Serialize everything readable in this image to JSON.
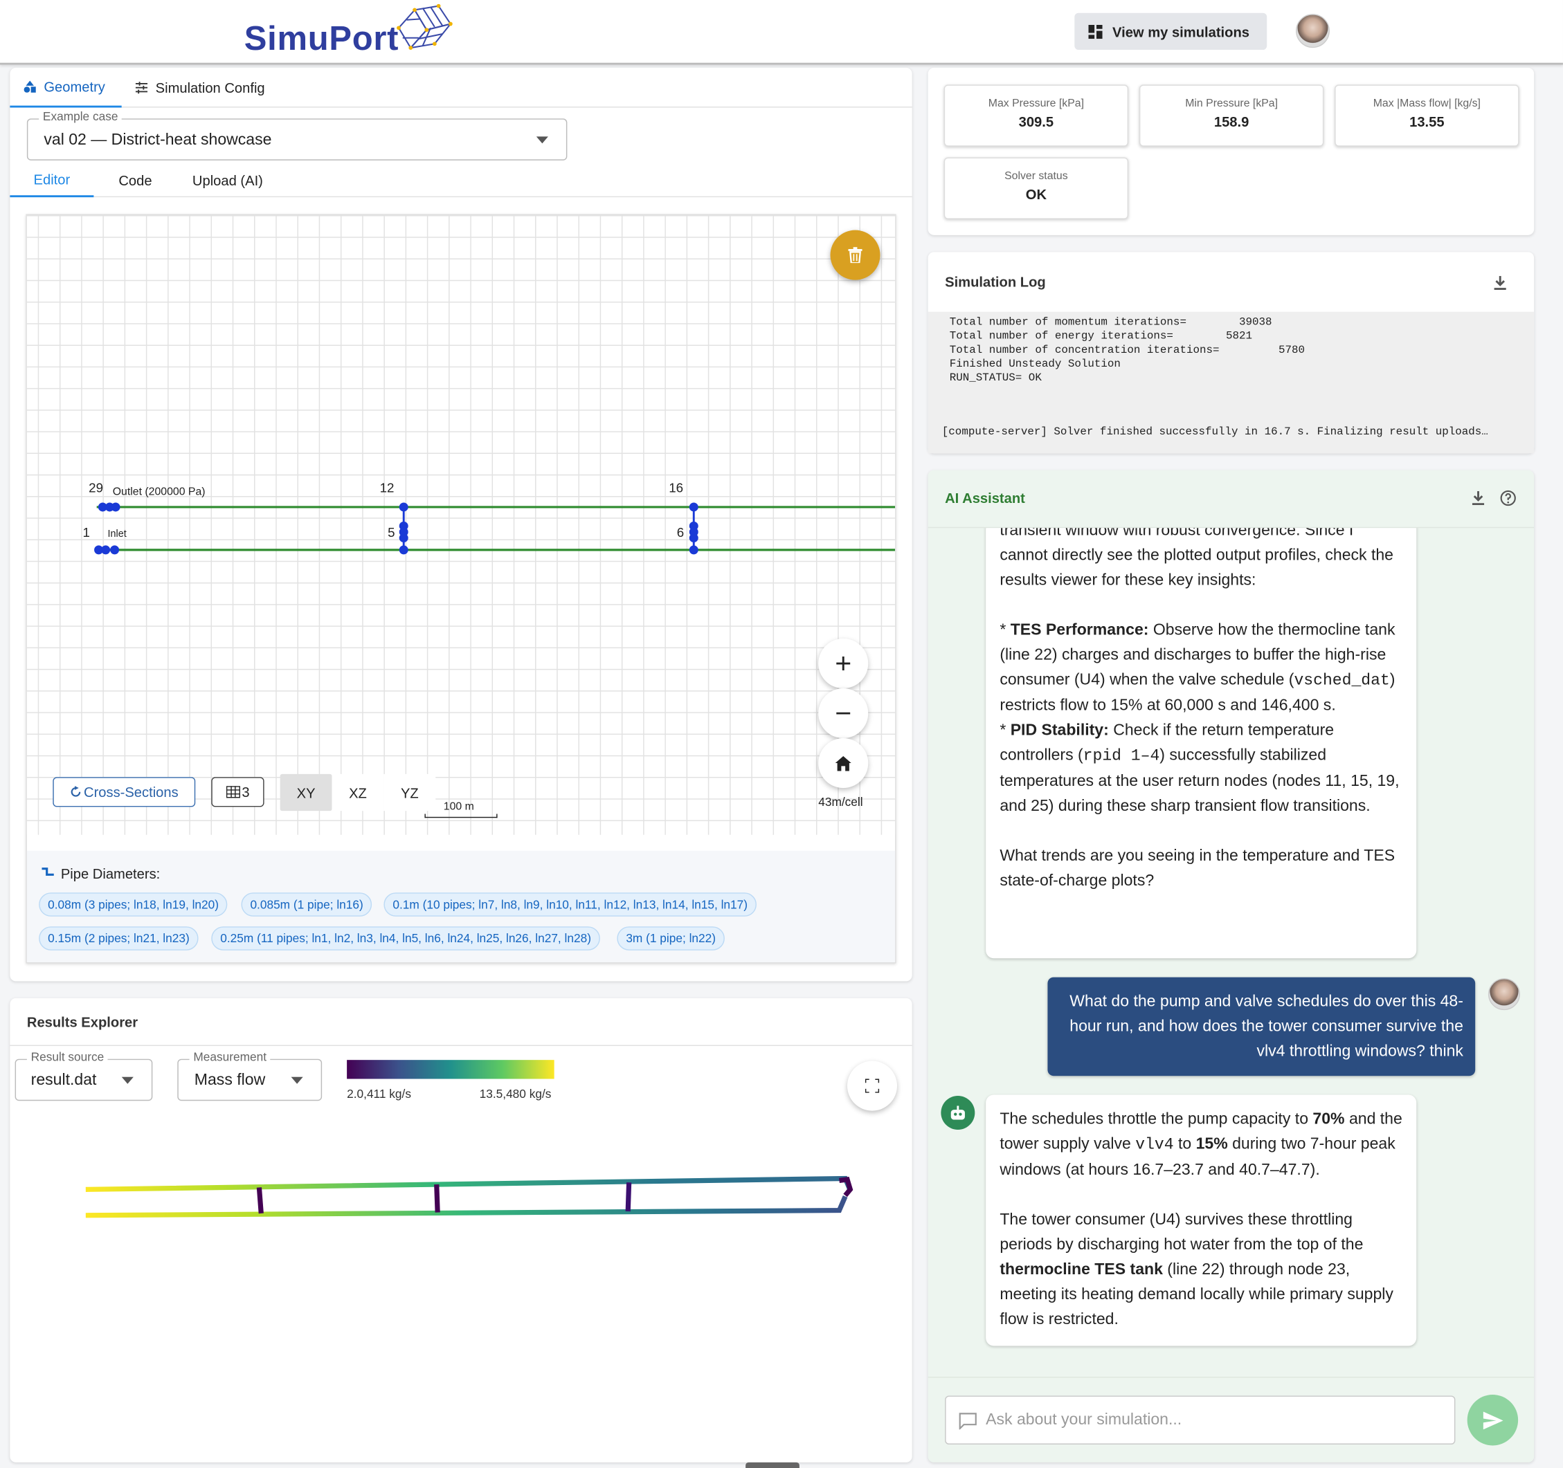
{
  "header": {
    "logo_text": "SimuPort",
    "view_button": "View my simulations"
  },
  "left_tabs": [
    {
      "label": "Geometry"
    },
    {
      "label": "Simulation Config"
    }
  ],
  "example_case": {
    "label": "Example case",
    "value": "val 02 — District-heat showcase"
  },
  "editor_tabs": [
    "Editor",
    "Code",
    "Upload (AI)"
  ],
  "canvas": {
    "node_labels": {
      "n29": "29",
      "n12": "12",
      "n16": "16",
      "n1": "1",
      "n5": "5",
      "n6": "6"
    },
    "outlet_label": "Outlet (200000 Pa)",
    "inlet_label": "Inlet",
    "cross_sections": "Cross-Sections",
    "grid_count": "3",
    "planes": [
      "XY",
      "XZ",
      "YZ"
    ],
    "scale_label": "100 m",
    "cell_size": "43m/cell",
    "colors": {
      "pipe": "#2e8b2e",
      "node": "#1a3ad6",
      "delete_button": "#d9a021"
    }
  },
  "pipe_diameters": {
    "title": "Pipe Diameters:",
    "chips": [
      "0.08m (3 pipes; ln18, ln19, ln20)",
      "0.085m (1 pipe; ln16)",
      "0.1m (10 pipes; ln7, ln8, ln9, ln10, ln11, ln12, ln13, ln14, ln15, ln17)",
      "0.15m (2 pipes; ln21, ln23)",
      "0.25m (11 pipes; ln1, ln2, ln3, ln4, ln5, ln6, ln24, ln25, ln26, ln27, ln28)",
      "3m (1 pipe; ln22)"
    ]
  },
  "results": {
    "title": "Results Explorer",
    "source_label": "Result source",
    "source_value": "result.dat",
    "measurement_label": "Measurement",
    "measurement_value": "Mass flow",
    "legend_min": "2.0,411 kg/s",
    "legend_max": "13.5,480 kg/s"
  },
  "stats": [
    {
      "label": "Max Pressure [kPa]",
      "value": "309.5"
    },
    {
      "label": "Min Pressure [kPa]",
      "value": "158.9"
    },
    {
      "label": "Max |Mass flow| [kg/s]",
      "value": "13.55"
    },
    {
      "label": "Solver status",
      "value": "OK"
    }
  ],
  "sim_log": {
    "title": "Simulation Log",
    "lines": [
      " Total number of momentum iterations=        39038",
      " Total number of energy iterations=        5821",
      " Total number of concentration iterations=         5780",
      " Finished Unsteady Solution",
      " RUN_STATUS= OK"
    ],
    "footer": "[compute-server] Solver finished successfully in 16.7 s. Finalizing result uploads…"
  },
  "assistant": {
    "title": "AI Assistant",
    "msg1": {
      "p1": "transient window with robust convergence. Since I cannot directly see the plotted output profiles, check the results viewer for these key insights:",
      "b1_pre": "* ",
      "b1_bold": "TES Performance:",
      "b1_text": " Observe how the thermocline tank (line 22) charges and discharges to buffer the high-rise consumer (U4) when the valve schedule (",
      "b1_code": "vsched_dat",
      "b1_text2": ") restricts flow to 15% at 60,000 s and 146,400 s.",
      "b2_pre": "* ",
      "b2_bold": "PID Stability:",
      "b2_text": " Check if the return temperature controllers (",
      "b2_code": "rpid 1–4",
      "b2_text2": ") successfully stabilized temperatures at the user return nodes (nodes 11, 15, 19, and 25) during these sharp transient flow transitions.",
      "p3": "What trends are you seeing in the temperature and TES state-of-charge plots?"
    },
    "user_msg": "What do the pump and valve schedules do over this 48-hour run, and how does the tower consumer survive the vlv4 throttling windows? think",
    "msg2": {
      "t1": "The schedules throttle the pump capacity to ",
      "t1b": "70%",
      "t2": " and the tower supply valve ",
      "t2c": "vlv4",
      "t3": " to ",
      "t3b": "15%",
      "t4": " during two 7-hour peak windows (at hours 16.7–23.7 and 40.7–47.7).",
      "p2a": "The tower consumer (U4) survives these throttling periods by discharging hot water from the top of the ",
      "p2b": "thermocline TES tank",
      "p2c": " (line 22) through node 23, meeting its heating demand locally while primary supply flow is restricted."
    },
    "input_placeholder": "Ask about your simulation..."
  }
}
